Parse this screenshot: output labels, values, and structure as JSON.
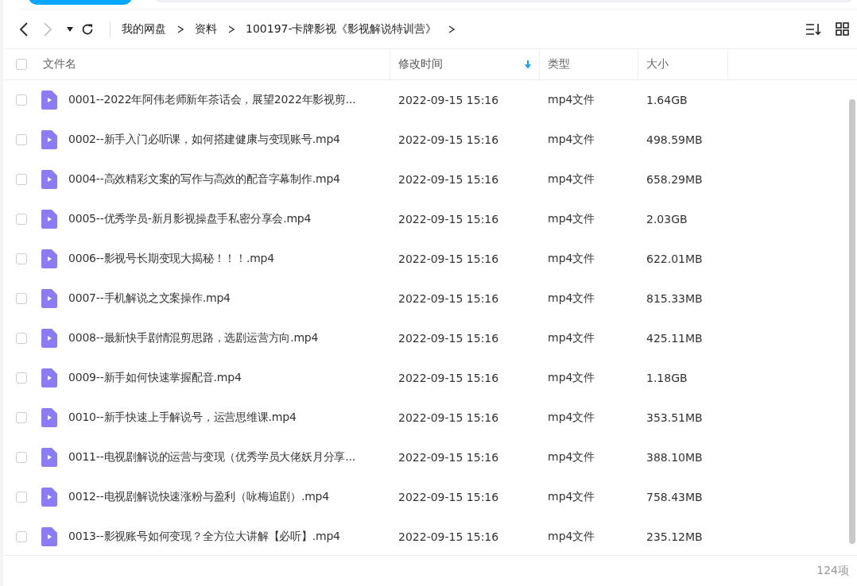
{
  "breadcrumb": [
    "我的网盘",
    "资料",
    "100197-卡牌影视《影视解说特训营》"
  ],
  "table": {
    "select_all_checked": false,
    "columns": [
      {
        "label": "文件名",
        "sorted": false
      },
      {
        "label": "修改时间",
        "sorted": true
      },
      {
        "label": "类型",
        "sorted": false
      },
      {
        "label": "大小",
        "sorted": false
      }
    ],
    "rows": [
      {
        "name": "0001--2022年阿伟老师新年茶话会，展望2022年影视剪...",
        "modified": "2022-09-15 15:16",
        "type": "mp4文件",
        "size": "1.64GB",
        "checked": false
      },
      {
        "name": "0002--新手入门必听课，如何搭建健康与变现账号.mp4",
        "modified": "2022-09-15 15:16",
        "type": "mp4文件",
        "size": "498.59MB",
        "checked": false
      },
      {
        "name": "0004--高效精彩文案的写作与高效的配音字幕制作.mp4",
        "modified": "2022-09-15 15:16",
        "type": "mp4文件",
        "size": "658.29MB",
        "checked": false
      },
      {
        "name": "0005--优秀学员-新月影视操盘手私密分享会.mp4",
        "modified": "2022-09-15 15:16",
        "type": "mp4文件",
        "size": "2.03GB",
        "checked": false
      },
      {
        "name": "0006--影视号长期变现大揭秘！！！.mp4",
        "modified": "2022-09-15 15:16",
        "type": "mp4文件",
        "size": "622.01MB",
        "checked": false
      },
      {
        "name": "0007--手机解说之文案操作.mp4",
        "modified": "2022-09-15 15:16",
        "type": "mp4文件",
        "size": "815.33MB",
        "checked": false
      },
      {
        "name": "0008--最新快手剧情混剪思路，选剧运营方向.mp4",
        "modified": "2022-09-15 15:16",
        "type": "mp4文件",
        "size": "425.11MB",
        "checked": false
      },
      {
        "name": "0009--新手如何快速掌握配音.mp4",
        "modified": "2022-09-15 15:16",
        "type": "mp4文件",
        "size": "1.18GB",
        "checked": false
      },
      {
        "name": "0010--新手快速上手解说号，运营思维课.mp4",
        "modified": "2022-09-15 15:16",
        "type": "mp4文件",
        "size": "353.51MB",
        "checked": false
      },
      {
        "name": "0011--电视剧解说的运营与变现（优秀学员大佬妖月分享...",
        "modified": "2022-09-15 15:16",
        "type": "mp4文件",
        "size": "388.10MB",
        "checked": false
      },
      {
        "name": "0012--电视剧解说快速涨粉与盈利（咏梅追剧）.mp4",
        "modified": "2022-09-15 15:16",
        "type": "mp4文件",
        "size": "758.43MB",
        "checked": false
      },
      {
        "name": "0013--影视账号如何变现？全方位大讲解【必听】.mp4",
        "modified": "2022-09-15 15:16",
        "type": "mp4文件",
        "size": "235.12MB",
        "checked": false
      }
    ]
  },
  "status_bar": {
    "count": "124项"
  }
}
